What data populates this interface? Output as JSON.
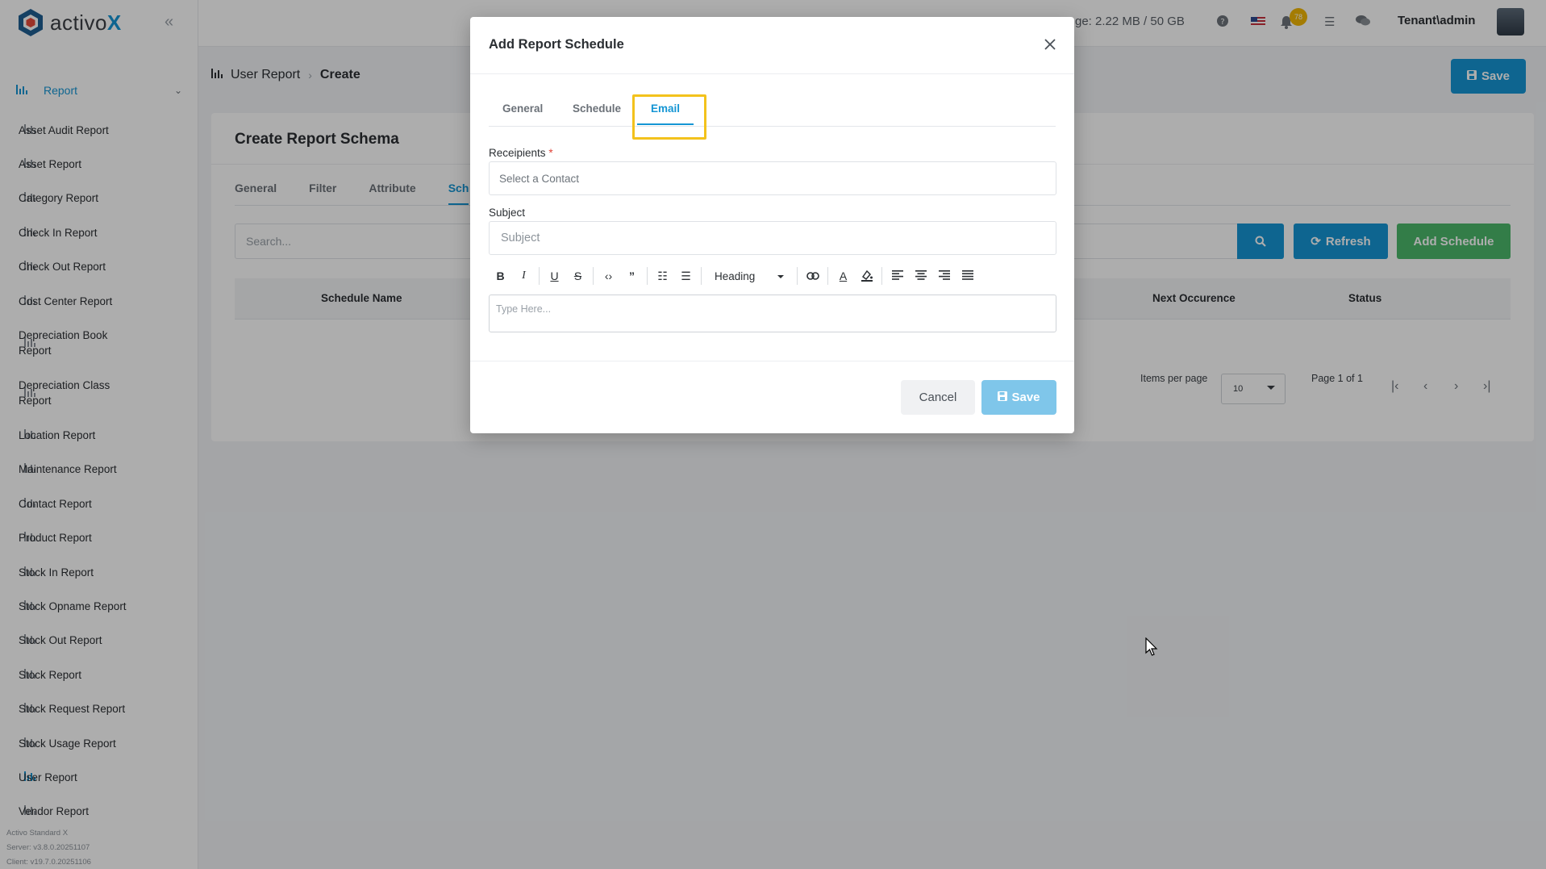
{
  "app": {
    "logo_prefix": "activo",
    "logo_suffix": "X"
  },
  "sidebar": {
    "section_label": "Report",
    "items": [
      {
        "label": "Asset Audit Report"
      },
      {
        "label": "Asset Report"
      },
      {
        "label": "Category Report"
      },
      {
        "label": "Check In Report"
      },
      {
        "label": "Check Out Report"
      },
      {
        "label": "Cost Center Report"
      },
      {
        "label": "Depreciation Book Report"
      },
      {
        "label": "Depreciation Class Report"
      },
      {
        "label": "Location Report"
      },
      {
        "label": "Maintenance Report"
      },
      {
        "label": "Contact Report"
      },
      {
        "label": "Product Report"
      },
      {
        "label": "Stock In Report"
      },
      {
        "label": "Stock Opname Report"
      },
      {
        "label": "Stock Out Report"
      },
      {
        "label": "Stock Report"
      },
      {
        "label": "Stock Request Report"
      },
      {
        "label": "Stock Usage Report"
      },
      {
        "label": "User Report"
      },
      {
        "label": "Vendor Report"
      }
    ],
    "active_item": "User Report",
    "footer": {
      "product": "Activo Standard X",
      "server": "Server: v3.8.0.20251107",
      "client": "Client: v19.7.0.20251106"
    }
  },
  "topbar": {
    "storage_text": "ge: 2.22 MB / 50 GB",
    "notification_count": "78",
    "user_name": "Tenant\\admin"
  },
  "breadcrumb": {
    "section": "User Report",
    "current": "Create"
  },
  "page": {
    "save_label": "Save",
    "card_title": "Create Report Schema",
    "tabs": [
      "General",
      "Filter",
      "Attribute",
      "Sch"
    ],
    "search_placeholder": "Search...",
    "refresh_label": "Refresh",
    "add_schedule_label": "Add Schedule",
    "table_headers": {
      "schedule_name": "Schedule Name",
      "next_occurence": "Next Occurence",
      "status": "Status"
    },
    "pagination": {
      "items_per_page_label": "Items per page",
      "items_per_page_value": "10",
      "page_info": "Page 1 of 1"
    }
  },
  "modal": {
    "title": "Add Report Schedule",
    "tabs": [
      "General",
      "Schedule",
      "Email"
    ],
    "active_tab": "Email",
    "recipients_label": "Receipients",
    "required_mark": "*",
    "recipients_placeholder": "Select a Contact",
    "subject_label": "Subject",
    "subject_placeholder": "Subject",
    "heading_select": "Heading",
    "editor_placeholder": "Type Here...",
    "cancel_label": "Cancel",
    "save_label": "Save"
  },
  "colors": {
    "primary": "#1596d4",
    "success": "#4cb86b",
    "highlight": "#f3c21c",
    "badge": "#f2b705"
  }
}
